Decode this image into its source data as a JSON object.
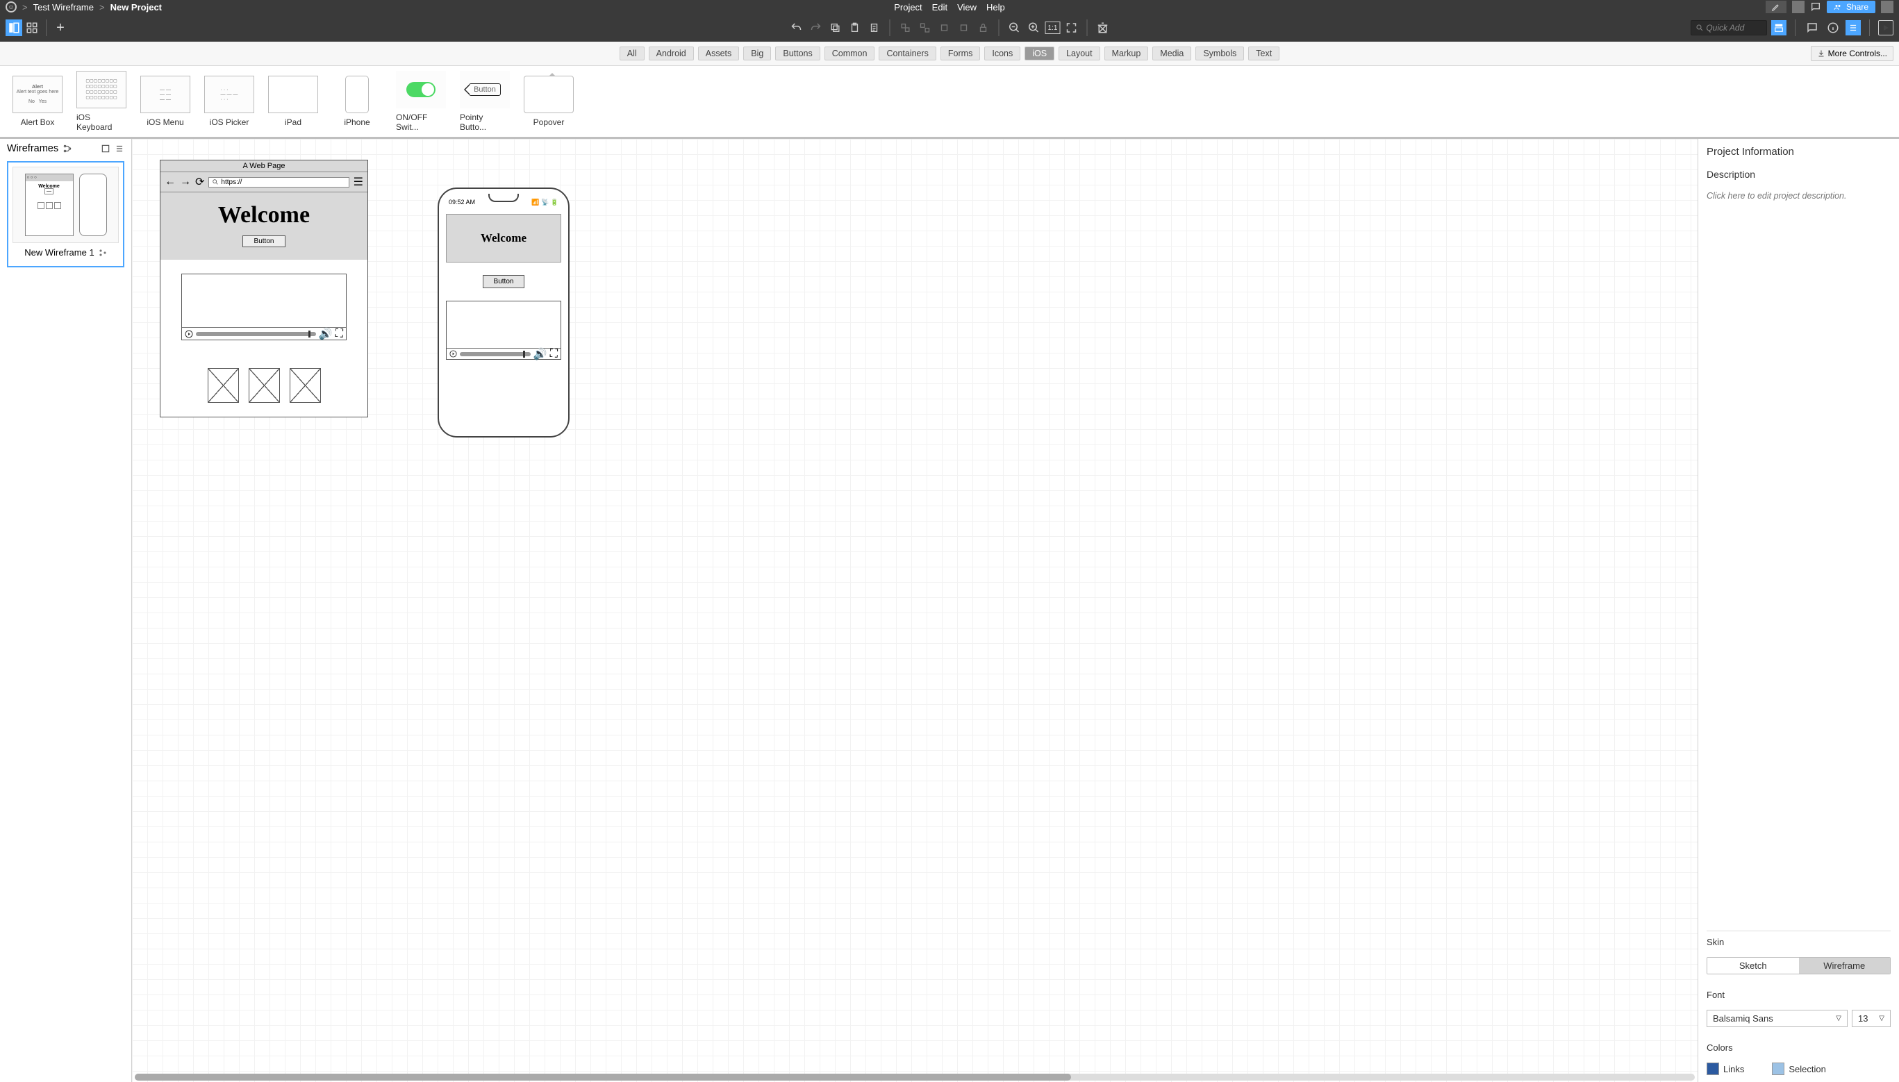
{
  "breadcrumb": {
    "project": "Test Wireframe",
    "page": "New Project"
  },
  "menubar": [
    "Project",
    "Edit",
    "View",
    "Help"
  ],
  "share_label": "Share",
  "quickadd_placeholder": "Quick Add",
  "categories": [
    "All",
    "Android",
    "Assets",
    "Big",
    "Buttons",
    "Common",
    "Containers",
    "Forms",
    "Icons",
    "iOS",
    "Layout",
    "Markup",
    "Media",
    "Symbols",
    "Text"
  ],
  "categories_active": "iOS",
  "more_controls": "More Controls...",
  "library": [
    {
      "label": "Alert Box",
      "kind": "alert"
    },
    {
      "label": "iOS Keyboard",
      "kind": "keyboard"
    },
    {
      "label": "iOS Menu",
      "kind": "menu"
    },
    {
      "label": "iOS Picker",
      "kind": "picker"
    },
    {
      "label": "iPad",
      "kind": "ipad"
    },
    {
      "label": "iPhone",
      "kind": "iphone"
    },
    {
      "label": "ON/OFF Swit...",
      "kind": "switch"
    },
    {
      "label": "Pointy Butto...",
      "kind": "pointy"
    },
    {
      "label": "Popover",
      "kind": "popover"
    }
  ],
  "leftpanel": {
    "title": "Wireframes",
    "thumb_name": "New Wireframe 1"
  },
  "canvas": {
    "browser": {
      "title": "A Web Page",
      "url": "https://",
      "heading": "Welcome",
      "button": "Button"
    },
    "phone": {
      "time": "09:52 AM",
      "heading": "Welcome",
      "button": "Button"
    }
  },
  "rightpanel": {
    "title": "Project Information",
    "description_label": "Description",
    "description_placeholder": "Click here to edit project description.",
    "skin_label": "Skin",
    "skin_opts": [
      "Sketch",
      "Wireframe"
    ],
    "skin_selected": "Wireframe",
    "font_label": "Font",
    "font_family": "Balsamiq Sans",
    "font_size": "13",
    "colors_label": "Colors",
    "colors": [
      "Links",
      "Selection"
    ]
  }
}
